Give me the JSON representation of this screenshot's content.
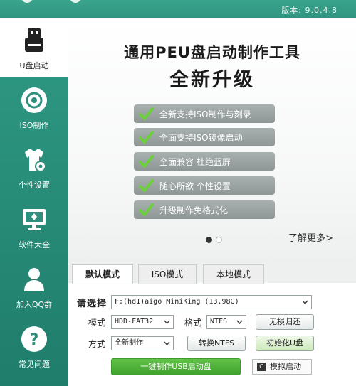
{
  "window": {
    "version": "版本: 9.0.4.8"
  },
  "sidebar": {
    "items": [
      {
        "label": "U盘启动",
        "icon": "usb-drive-icon",
        "active": true
      },
      {
        "label": "ISO制作",
        "icon": "disc-icon"
      },
      {
        "label": "个性设置",
        "icon": "shirt-gear-icon"
      },
      {
        "label": "软件大全",
        "icon": "monitor-icon"
      },
      {
        "label": "加入QQ群",
        "icon": "person-icon"
      },
      {
        "label": "常见问题",
        "icon": "question-icon"
      }
    ]
  },
  "banner": {
    "title": "通用PEU盘启动制作工具",
    "subtitle": "全新升级",
    "features": [
      "全新支持ISO制作与刻录",
      "全面支持ISO镜像启动",
      "全面兼容 杜绝蓝屏",
      "随心所欲 个性设置",
      "升级制作免格式化"
    ],
    "more_link": "了解更多>",
    "carousel_active_index": 0,
    "carousel_count": 2
  },
  "tabs": [
    {
      "label": "默认模式",
      "active": true
    },
    {
      "label": "ISO模式",
      "active": false
    },
    {
      "label": "本地模式",
      "active": false
    }
  ],
  "form": {
    "device_label": "请选择",
    "device_value": "F:(hd1)aigo MiniKing (13.98G)",
    "mode_label": "模式",
    "mode_value": "HDD-FAT32",
    "format_label": "格式",
    "format_value": "NTFS",
    "method_label": "方式",
    "method_value": "全新制作",
    "restore_button": "无损归还",
    "convert_ntfs_button": "转换NTFS",
    "init_usb_button": "初始化U盘",
    "make_button": "一键制作USB启动盘",
    "simulate_button": "模拟启动",
    "simulate_icon_text": "C"
  },
  "colors": {
    "sidebar": "#2e8f7c",
    "accent_green": "#4cb137",
    "feature_bg": "#9aa1a1"
  }
}
